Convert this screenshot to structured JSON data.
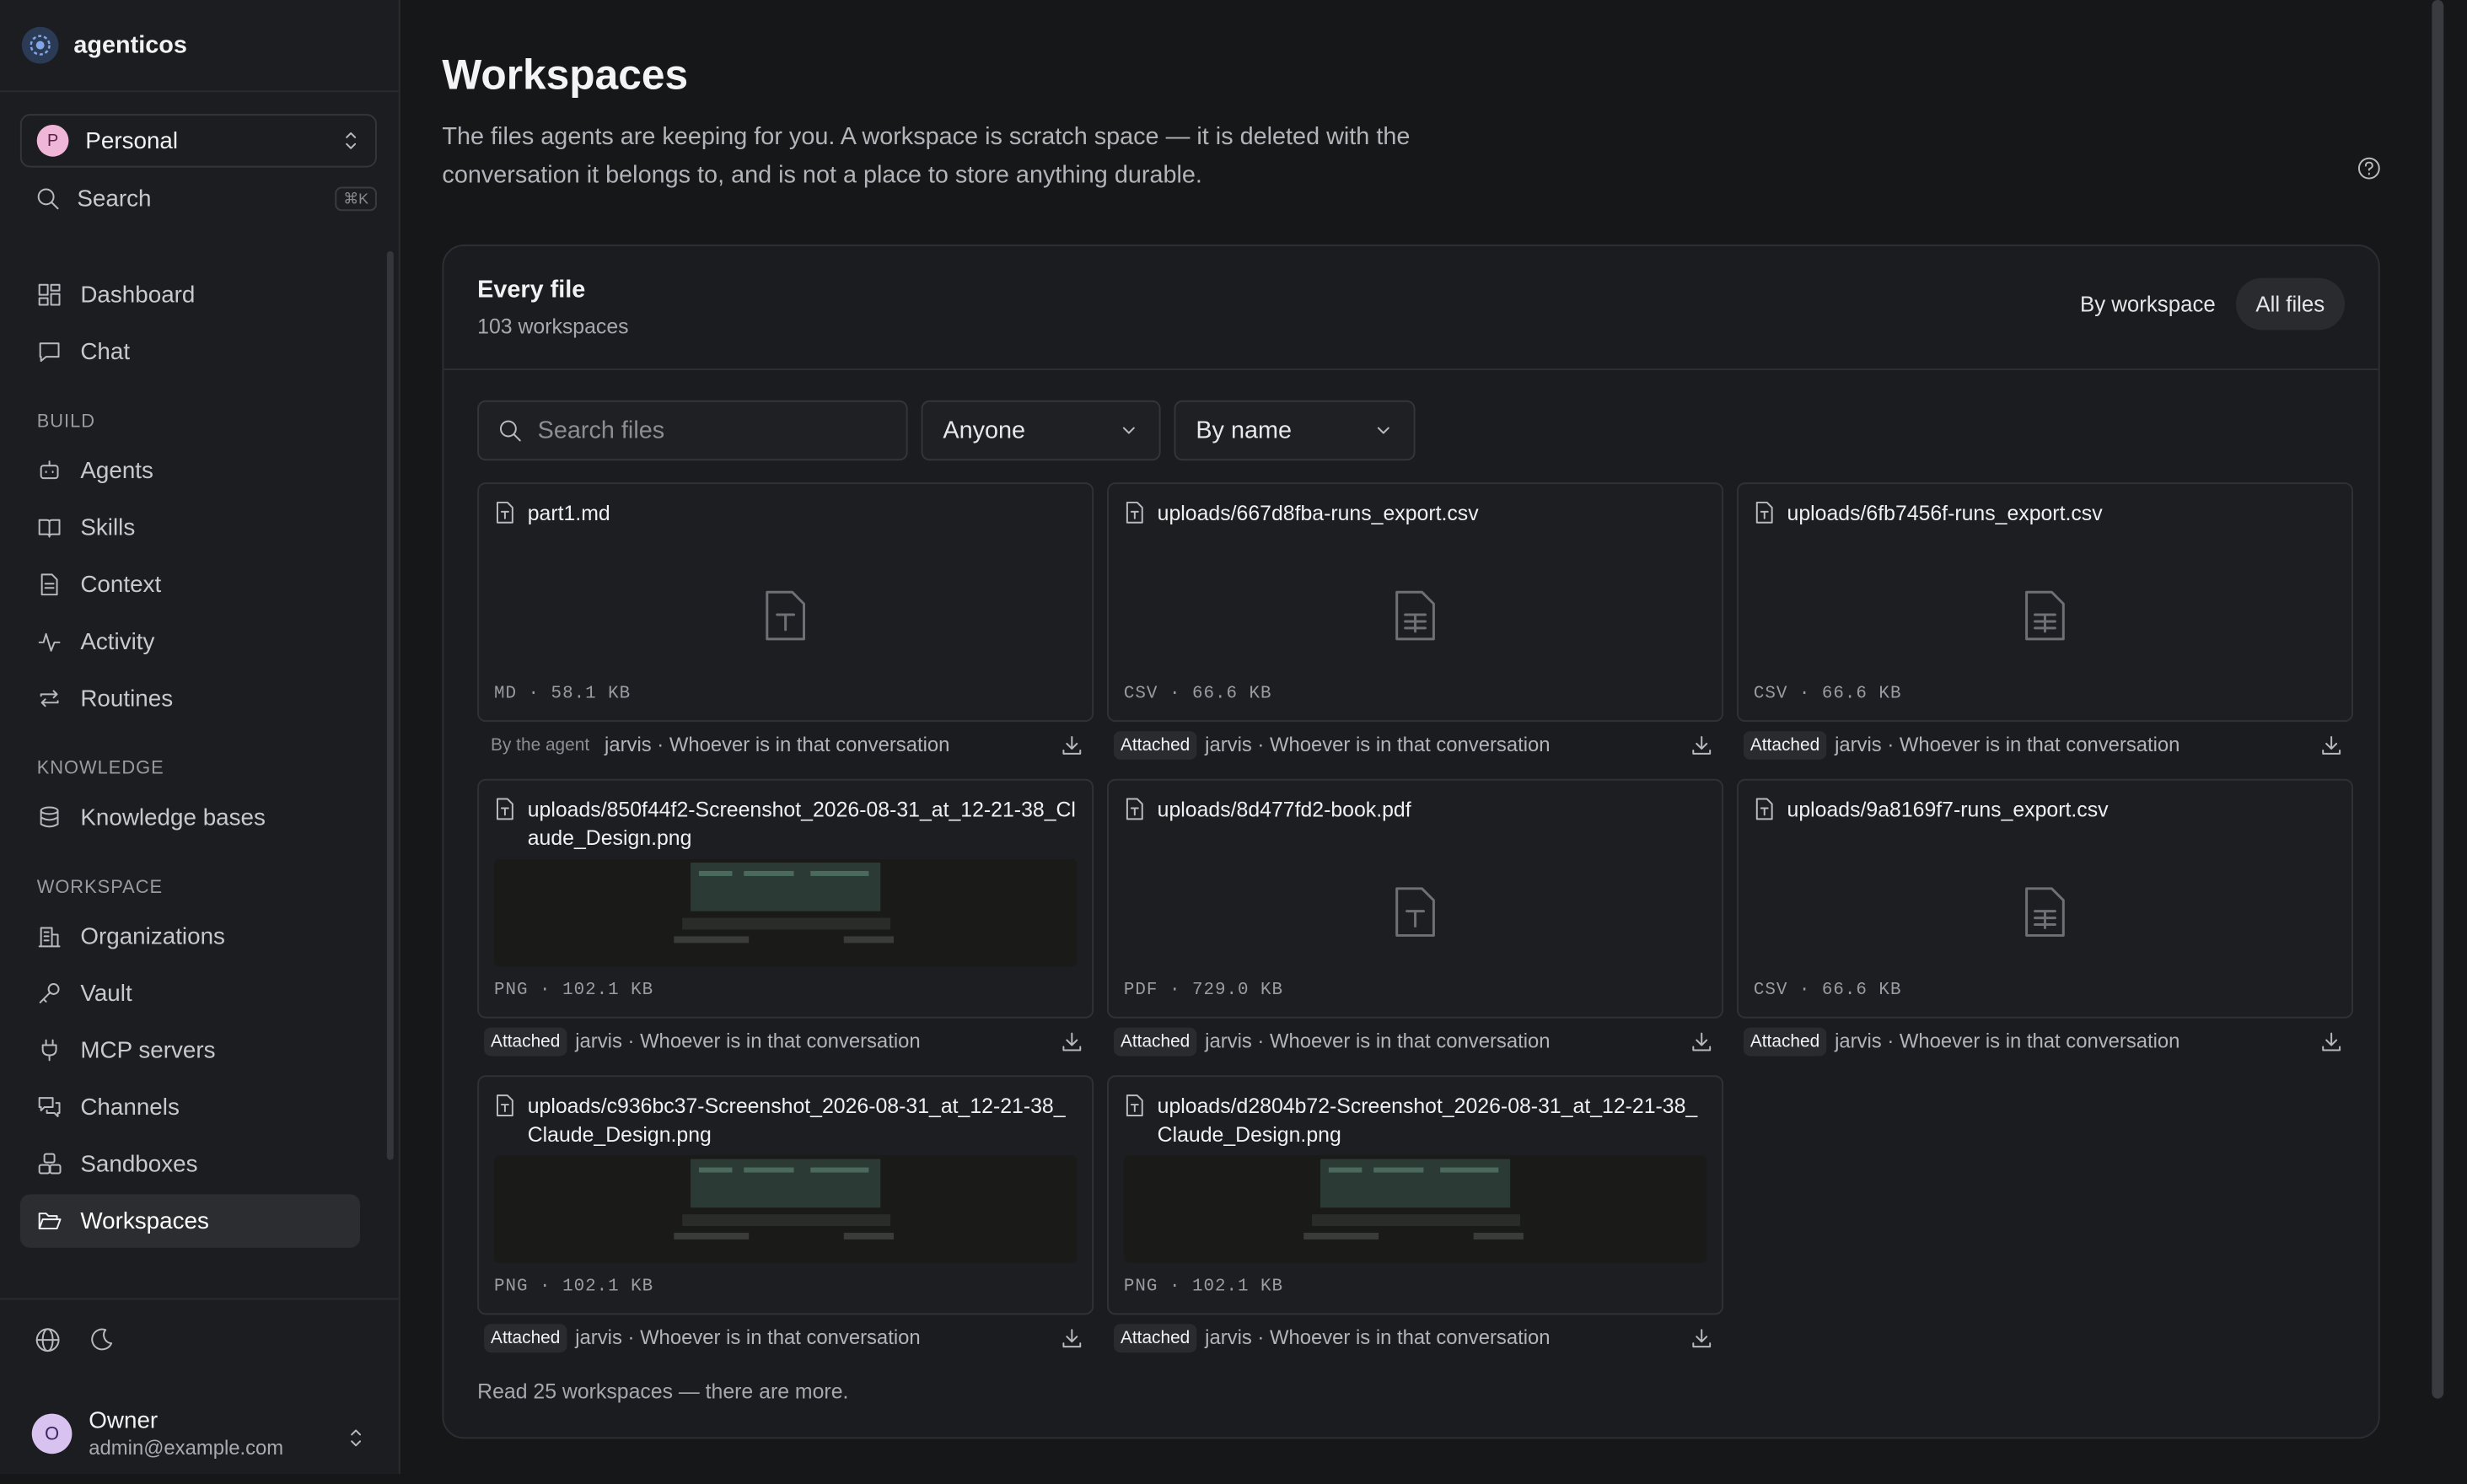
{
  "app": {
    "name": "agenticos"
  },
  "account": {
    "initial": "P",
    "name": "Personal"
  },
  "search": {
    "label": "Search",
    "shortcut": "⌘K"
  },
  "nav": {
    "top": [
      {
        "label": "Dashboard",
        "icon": "dashboard-icon"
      },
      {
        "label": "Chat",
        "icon": "chat-icon"
      }
    ],
    "sections": [
      {
        "title": "BUILD",
        "items": [
          "Agents",
          "Skills",
          "Context",
          "Activity",
          "Routines"
        ]
      },
      {
        "title": "KNOWLEDGE",
        "items": [
          "Knowledge bases"
        ]
      },
      {
        "title": "WORKSPACE",
        "items": [
          "Organizations",
          "Vault",
          "MCP servers",
          "Channels",
          "Sandboxes",
          "Workspaces"
        ]
      }
    ],
    "active": "Workspaces"
  },
  "user": {
    "initial": "O",
    "name": "Owner",
    "email": "admin@example.com"
  },
  "page": {
    "title": "Workspaces",
    "description": "The files agents are keeping for you. A workspace is scratch space — it is deleted with the conversation it belongs to, and is not a place to store anything durable."
  },
  "card": {
    "title": "Every file",
    "subtitle": "103 workspaces",
    "toggle": {
      "by_workspace": "By workspace",
      "all_files": "All files",
      "active": "All files"
    }
  },
  "filters": {
    "search_placeholder": "Search files",
    "owner": "Anyone",
    "sort": "By name"
  },
  "files": [
    {
      "name": "part1.md",
      "type": "MD",
      "size": "58.1 KB",
      "badge": "By the agent",
      "badge_style": "plain",
      "agent": "jarvis",
      "access": "Whoever is in that conversation",
      "preview": "text"
    },
    {
      "name": "uploads/667d8fba-runs_export.csv",
      "type": "CSV",
      "size": "66.6 KB",
      "badge": "Attached",
      "badge_style": "pill",
      "agent": "jarvis",
      "access": "Whoever is in that conversation",
      "preview": "sheet"
    },
    {
      "name": "uploads/6fb7456f-runs_export.csv",
      "type": "CSV",
      "size": "66.6 KB",
      "badge": "Attached",
      "badge_style": "pill",
      "agent": "jarvis",
      "access": "Whoever is in that conversation",
      "preview": "sheet"
    },
    {
      "name": "uploads/850f44f2-Screenshot_2026-08-31_at_12-21-38_Claude_Design.png",
      "type": "PNG",
      "size": "102.1 KB",
      "badge": "Attached",
      "badge_style": "pill",
      "agent": "jarvis",
      "access": "Whoever is in that conversation",
      "preview": "image"
    },
    {
      "name": "uploads/8d477fd2-book.pdf",
      "type": "PDF",
      "size": "729.0 KB",
      "badge": "Attached",
      "badge_style": "pill",
      "agent": "jarvis",
      "access": "Whoever is in that conversation",
      "preview": "text"
    },
    {
      "name": "uploads/9a8169f7-runs_export.csv",
      "type": "CSV",
      "size": "66.6 KB",
      "badge": "Attached",
      "badge_style": "pill",
      "agent": "jarvis",
      "access": "Whoever is in that conversation",
      "preview": "sheet"
    },
    {
      "name": "uploads/c936bc37-Screenshot_2026-08-31_at_12-21-38_Claude_Design.png",
      "type": "PNG",
      "size": "102.1 KB",
      "badge": "Attached",
      "badge_style": "pill",
      "agent": "jarvis",
      "access": "Whoever is in that conversation",
      "preview": "image"
    },
    {
      "name": "uploads/d2804b72-Screenshot_2026-08-31_at_12-21-38_Claude_Design.png",
      "type": "PNG",
      "size": "102.1 KB",
      "badge": "Attached",
      "badge_style": "pill",
      "agent": "jarvis",
      "access": "Whoever is in that conversation",
      "preview": "image"
    }
  ],
  "footer_note": "Read 25 workspaces — there are more."
}
